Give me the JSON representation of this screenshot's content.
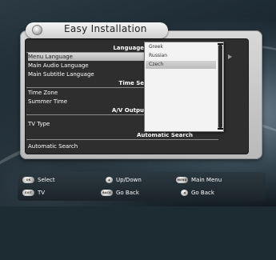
{
  "dialog": {
    "title": "Easy Installation",
    "sections": {
      "language": "Language",
      "time": "Time Se",
      "av": "A/V Outpu",
      "search": "Automatic Search"
    },
    "items": {
      "menu_language": "Menu Language",
      "main_audio": "Main Audio Language",
      "main_subtitle": "Main Subtitle Language",
      "time_zone": "Time Zone",
      "summer_time": "Summer Time",
      "tv_type": "TV Type",
      "automatic_search": "Automatic Search"
    }
  },
  "dropdown": {
    "options": [
      "Greek",
      "Russian",
      "Czech"
    ],
    "selected": "Czech"
  },
  "footer": {
    "select": {
      "key": "OK",
      "label": "Select"
    },
    "updown": {
      "key": "◆",
      "label": "Up/Down"
    },
    "mainmenu": {
      "key": "MENU",
      "label": "Main Menu"
    },
    "tv": {
      "key": "EXIT",
      "label": "TV"
    },
    "goback1": {
      "key": "BACK",
      "label": "Go Back"
    },
    "goback2": {
      "key": "◀",
      "label": "Go Back"
    }
  }
}
